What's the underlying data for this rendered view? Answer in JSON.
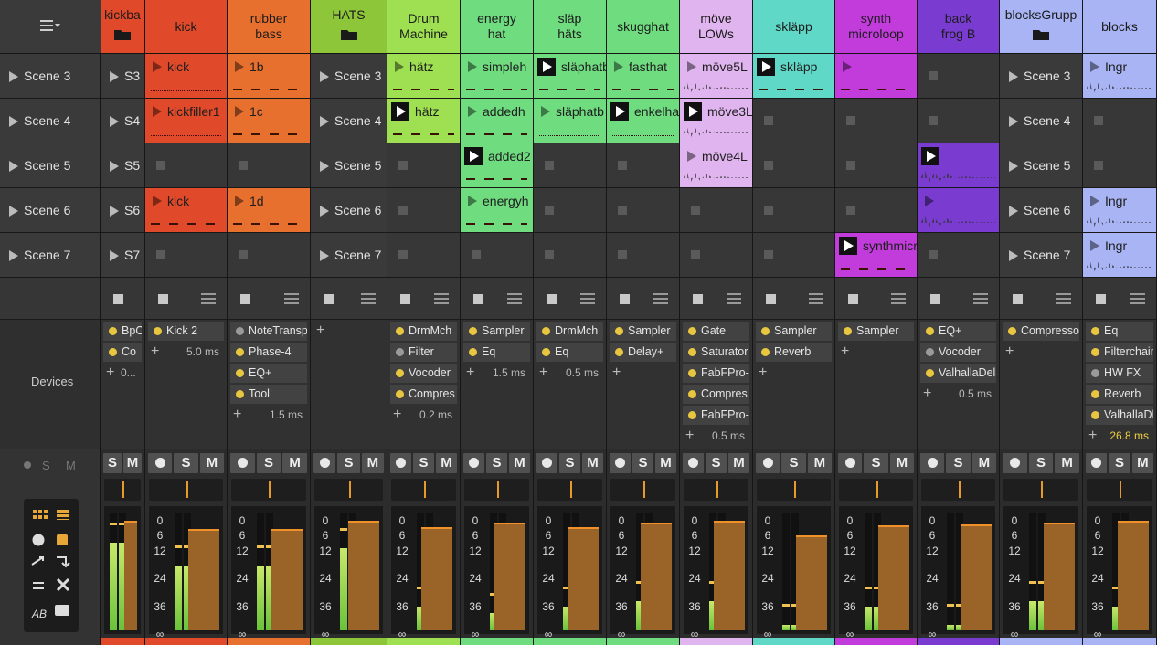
{
  "toolbar": {
    "menu_icon": "list-menu-icon"
  },
  "scenes": [
    "Scene 3",
    "Scene 4",
    "Scene 5",
    "Scene 6",
    "Scene 7"
  ],
  "left_panel": {
    "devices_label": "Devices"
  },
  "tracks": [
    {
      "name": "kickba",
      "color": "#e04a2a",
      "folder": true,
      "scene_labels": [
        "S3",
        "S4",
        "S5",
        "S6",
        "S7"
      ],
      "devices": [
        {
          "name": "BpCh",
          "on": true
        },
        {
          "name": "Co",
          "on": true
        }
      ],
      "latency": "0...",
      "buttons": [
        "S",
        "M"
      ]
    },
    {
      "name": "kick",
      "color": "#e04a2a",
      "clips": [
        {
          "name": "kick",
          "style": "dots"
        },
        {
          "name": "kickfiller1",
          "style": "dots"
        },
        null,
        {
          "name": "kick",
          "style": "dash"
        },
        null
      ],
      "devices": [
        {
          "name": "Kick 2",
          "on": true
        }
      ],
      "latency": "5.0 ms",
      "buttons": [
        "S",
        "M"
      ]
    },
    {
      "name": "rubber\nbass",
      "color": "#e8702e",
      "clips": [
        {
          "name": "1b",
          "style": "dash"
        },
        {
          "name": "1c",
          "style": "dash"
        },
        null,
        {
          "name": "1d",
          "style": "dash"
        },
        null
      ],
      "devices": [
        {
          "name": "NoteTranspo",
          "on": false
        },
        {
          "name": "Phase-4",
          "on": true
        },
        {
          "name": "EQ+",
          "on": true
        },
        {
          "name": "Tool",
          "on": true
        }
      ],
      "latency": "1.5 ms",
      "buttons": [
        "S",
        "M"
      ]
    },
    {
      "name": "HATS",
      "color": "#8ec63a",
      "folder": true,
      "scene_labels": [
        "Scene 3",
        "Scene 4",
        "Scene 5",
        "Scene 6",
        "Scene 7"
      ],
      "devices": [],
      "latency": "",
      "buttons": [
        "S",
        "M"
      ]
    },
    {
      "name": "Drum\nMachine",
      "color": "#9ee052",
      "clips": [
        {
          "name": "hätz",
          "style": "dash"
        },
        {
          "name": "hätz",
          "style": "dash",
          "playing": true
        },
        null,
        null,
        null
      ],
      "devices": [
        {
          "name": "DrmMch",
          "on": true
        },
        {
          "name": "Filter",
          "on": false
        },
        {
          "name": "Vocoder",
          "on": true
        },
        {
          "name": "Compres",
          "on": true
        }
      ],
      "latency": "0.2 ms",
      "buttons": [
        "S",
        "M"
      ]
    },
    {
      "name": "energy\nhat",
      "color": "#6fdc80",
      "clips": [
        {
          "name": "simpleh",
          "style": "dash"
        },
        {
          "name": "addedh",
          "style": "dash"
        },
        {
          "name": "added2",
          "style": "dash",
          "playing": true
        },
        {
          "name": "energyh",
          "style": "dash"
        },
        null
      ],
      "devices": [
        {
          "name": "Sampler",
          "on": true
        },
        {
          "name": "Eq",
          "on": true
        }
      ],
      "latency": "1.5 ms",
      "buttons": [
        "S",
        "M"
      ]
    },
    {
      "name": "släp\nhäts",
      "color": "#6fdc80",
      "clips": [
        {
          "name": "släphatb",
          "style": "dash",
          "playing": true
        },
        {
          "name": "släphatb",
          "style": "dots"
        },
        null,
        null,
        null
      ],
      "devices": [
        {
          "name": "DrmMch",
          "on": true
        },
        {
          "name": "Eq",
          "on": true
        }
      ],
      "latency": "0.5 ms",
      "buttons": [
        "S",
        "M"
      ]
    },
    {
      "name": "skugghat",
      "color": "#6fdc80",
      "clips": [
        {
          "name": "fasthat",
          "style": "dash"
        },
        {
          "name": "enkelha",
          "style": "dots",
          "playing": true
        },
        null,
        null,
        null
      ],
      "devices": [
        {
          "name": "Sampler",
          "on": true
        },
        {
          "name": "Delay+",
          "on": true
        }
      ],
      "latency": "",
      "buttons": [
        "S",
        "M"
      ]
    },
    {
      "name": "möve\nLOWs",
      "color": "#e0b4ee",
      "clips": [
        {
          "name": "möve5L",
          "style": "wav"
        },
        {
          "name": "möve3L",
          "style": "wav",
          "playing": true
        },
        {
          "name": "möve4L",
          "style": "wav"
        },
        null,
        null
      ],
      "devices": [
        {
          "name": "Gate",
          "on": true
        },
        {
          "name": "Saturator",
          "on": true
        },
        {
          "name": "FabFPro-3",
          "on": true
        },
        {
          "name": "Compres",
          "on": true
        },
        {
          "name": "FabFPro-R",
          "on": true
        }
      ],
      "latency": "0.5 ms",
      "buttons": [
        "S",
        "M"
      ]
    },
    {
      "name": "skläpp",
      "color": "#60d8c8",
      "clips": [
        {
          "name": "skläpp",
          "style": "dash",
          "playing": true
        },
        null,
        null,
        null,
        null
      ],
      "devices": [
        {
          "name": "Sampler",
          "on": true
        },
        {
          "name": "Reverb",
          "on": true
        }
      ],
      "latency": "",
      "buttons": [
        "S",
        "M"
      ]
    },
    {
      "name": "synth\nmicroloop",
      "color": "#c23cdc",
      "clips": [
        {
          "name": "",
          "style": "dash"
        },
        null,
        null,
        null,
        {
          "name": "synthmicr",
          "style": "dash",
          "playing": true
        }
      ],
      "devices": [
        {
          "name": "Sampler",
          "on": true
        }
      ],
      "latency": "",
      "buttons": [
        "S",
        "M"
      ]
    },
    {
      "name": "back\nfrog B",
      "color": "#7a3cd0",
      "clips": [
        null,
        null,
        {
          "name": "",
          "style": "wav",
          "playing": true
        },
        {
          "name": "",
          "style": "wav"
        },
        null
      ],
      "devices": [
        {
          "name": "EQ+",
          "on": true
        },
        {
          "name": "Vocoder",
          "on": false
        },
        {
          "name": "ValhallaDelay",
          "on": true
        }
      ],
      "latency": "0.5 ms",
      "buttons": [
        "S",
        "M"
      ]
    },
    {
      "name": "blocksGrupp",
      "color": "#a8b4f4",
      "folder": true,
      "scene_labels": [
        "Scene 3",
        "Scene 4",
        "Scene 5",
        "Scene 6",
        "Scene 7"
      ],
      "devices": [
        {
          "name": "Compresso",
          "on": true
        }
      ],
      "latency": "",
      "buttons": [
        "S",
        "M"
      ]
    },
    {
      "name": "blocks",
      "color": "#a8b4f4",
      "clips": [
        {
          "name": "Ingr",
          "style": "wav"
        },
        null,
        null,
        {
          "name": "Ingr",
          "style": "wav"
        },
        {
          "name": "Ingr",
          "style": "wav"
        }
      ],
      "devices": [
        {
          "name": "Eq",
          "on": true
        },
        {
          "name": "Filterchain",
          "on": true
        },
        {
          "name": "HW FX",
          "on": false
        },
        {
          "name": "Reverb",
          "on": true
        },
        {
          "name": "ValhallaDl",
          "on": true
        }
      ],
      "latency": "26.8 ms",
      "buttons": [
        "S",
        "M"
      ]
    }
  ],
  "meter_scale": [
    "0",
    "6",
    "12",
    "24",
    "36",
    "∞"
  ],
  "meter_levels": [
    0.75,
    0.55,
    0.55,
    0.7,
    0.2,
    0.15,
    0.2,
    0.25,
    0.25,
    0.05,
    0.2,
    0.05,
    0.25,
    0.2
  ],
  "fader_levels": [
    0.86,
    0.79,
    0.79,
    0.86,
    0.81,
    0.84,
    0.81,
    0.84,
    0.86,
    0.74,
    0.82,
    0.83,
    0.84,
    0.86
  ]
}
